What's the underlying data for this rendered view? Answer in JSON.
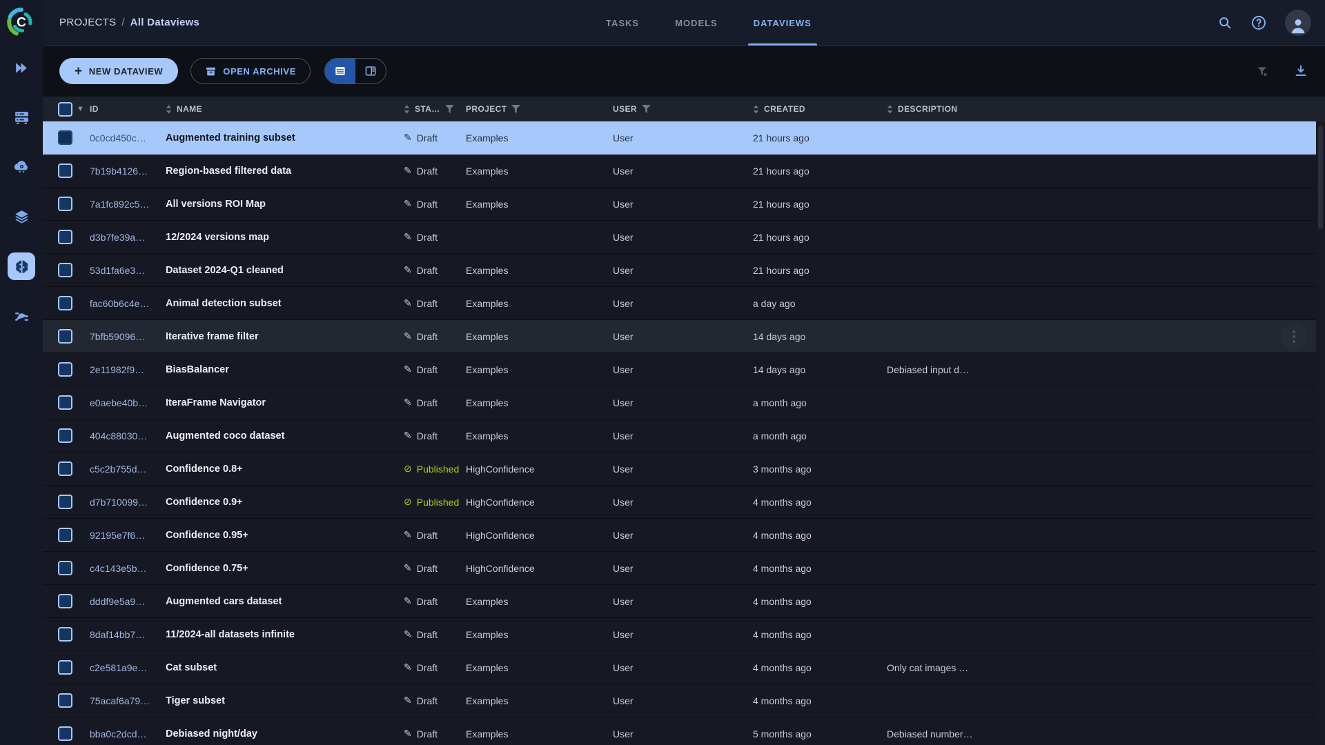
{
  "colors": {
    "accent_blue": "#85b1f4",
    "button_fill": "#a7c8fb",
    "selected_row_bg": "#a7c8fb",
    "published_green": "#a6d413",
    "row_bg": "#161923",
    "header_bg": "#171c2a",
    "table_header_bg": "#1e222d"
  },
  "sidebar": {
    "logo": "clearml-logo",
    "items": [
      {
        "name": "projects",
        "icon": "double-chevron-right-icon",
        "active": false
      },
      {
        "name": "workers-queues",
        "icon": "server-racks-icon",
        "active": false
      },
      {
        "name": "cloud-autoscale",
        "icon": "cloud-gear-icon",
        "active": false
      },
      {
        "name": "datasets",
        "icon": "layers-icon",
        "active": false
      },
      {
        "name": "hyper-datasets",
        "icon": "brain-icon",
        "active": true
      },
      {
        "name": "pipelines",
        "icon": "pipeline-icon",
        "active": false
      }
    ]
  },
  "header": {
    "breadcrumb": {
      "root": "PROJECTS",
      "separator": "/",
      "current": "All Dataviews"
    },
    "tabs": [
      {
        "label": "TASKS",
        "active": false
      },
      {
        "label": "MODELS",
        "active": false
      },
      {
        "label": "DATAVIEWS",
        "active": true
      }
    ],
    "icons": [
      "search-icon",
      "help-icon",
      "user-avatar"
    ]
  },
  "toolbar": {
    "new_dataview_label": "NEW DATAVIEW",
    "open_archive_label": "OPEN ARCHIVE",
    "view_toggle": [
      "table-view",
      "split-view"
    ],
    "right_icons": [
      "clear-filters-icon",
      "download-icon"
    ]
  },
  "table": {
    "status_icons": {
      "draft": "✎",
      "published": "⊘"
    },
    "columns": [
      {
        "label": "ID",
        "sortable": false,
        "filterable": false
      },
      {
        "label": "NAME",
        "sortable": true,
        "filterable": false
      },
      {
        "label": "STA…",
        "sortable": true,
        "filterable": true
      },
      {
        "label": "PROJECT",
        "sortable": false,
        "filterable": true
      },
      {
        "label": "USER",
        "sortable": false,
        "filterable": true
      },
      {
        "label": "CREATED",
        "sortable": true,
        "filterable": false
      },
      {
        "label": "DESCRIPTION",
        "sortable": true,
        "filterable": false
      }
    ],
    "rows": [
      {
        "id": "0c0cd450c…",
        "name": "Augmented training subset",
        "status": "Draft",
        "project": "Examples",
        "user": "User",
        "created": "21 hours ago",
        "description": "",
        "selected": true,
        "hovered": false
      },
      {
        "id": "7b19b4126…",
        "name": "Region-based filtered data",
        "status": "Draft",
        "project": "Examples",
        "user": "User",
        "created": "21 hours ago",
        "description": "",
        "selected": false,
        "hovered": false
      },
      {
        "id": "7a1fc892c5…",
        "name": "All versions ROI Map",
        "status": "Draft",
        "project": "Examples",
        "user": "User",
        "created": "21 hours ago",
        "description": "",
        "selected": false,
        "hovered": false
      },
      {
        "id": "d3b7fe39a…",
        "name": "12/2024 versions map",
        "status": "Draft",
        "project": "",
        "user": "User",
        "created": "21 hours ago",
        "description": "",
        "selected": false,
        "hovered": false
      },
      {
        "id": "53d1fa6e3…",
        "name": "Dataset 2024-Q1 cleaned",
        "status": "Draft",
        "project": "Examples",
        "user": "User",
        "created": "21 hours ago",
        "description": "",
        "selected": false,
        "hovered": false
      },
      {
        "id": "fac60b6c4e…",
        "name": "Animal detection subset",
        "status": "Draft",
        "project": "Examples",
        "user": "User",
        "created": "a day ago",
        "description": "",
        "selected": false,
        "hovered": false
      },
      {
        "id": "7bfb59096…",
        "name": "Iterative frame filter",
        "status": "Draft",
        "project": "Examples",
        "user": "User",
        "created": "14 days ago",
        "description": "",
        "selected": false,
        "hovered": true
      },
      {
        "id": "2e11982f9…",
        "name": "BiasBalancer",
        "status": "Draft",
        "project": "Examples",
        "user": "User",
        "created": "14 days ago",
        "description": "Debiased input d…",
        "selected": false,
        "hovered": false
      },
      {
        "id": "e0aebe40b…",
        "name": "IteraFrame Navigator",
        "status": "Draft",
        "project": "Examples",
        "user": "User",
        "created": "a month ago",
        "description": "",
        "selected": false,
        "hovered": false
      },
      {
        "id": "404c88030…",
        "name": "Augmented coco dataset",
        "status": "Draft",
        "project": "Examples",
        "user": "User",
        "created": "a month ago",
        "description": "",
        "selected": false,
        "hovered": false
      },
      {
        "id": "c5c2b755d…",
        "name": "Confidence 0.8+",
        "status": "Published",
        "project": "HighConfidence",
        "user": "User",
        "created": "3 months ago",
        "description": "",
        "selected": false,
        "hovered": false
      },
      {
        "id": "d7b710099…",
        "name": "Confidence 0.9+",
        "status": "Published",
        "project": "HighConfidence",
        "user": "User",
        "created": "4 months ago",
        "description": "",
        "selected": false,
        "hovered": false
      },
      {
        "id": "92195e7f6…",
        "name": "Confidence 0.95+",
        "status": "Draft",
        "project": "HighConfidence",
        "user": "User",
        "created": "4 months ago",
        "description": "",
        "selected": false,
        "hovered": false
      },
      {
        "id": "c4c143e5b…",
        "name": "Confidence 0.75+",
        "status": "Draft",
        "project": "HighConfidence",
        "user": "User",
        "created": "4 months ago",
        "description": "",
        "selected": false,
        "hovered": false
      },
      {
        "id": "dddf9e5a9…",
        "name": "Augmented cars dataset",
        "status": "Draft",
        "project": "Examples",
        "user": "User",
        "created": "4 months ago",
        "description": "",
        "selected": false,
        "hovered": false
      },
      {
        "id": "8daf14bb7…",
        "name": "11/2024-all datasets infinite",
        "status": "Draft",
        "project": "Examples",
        "user": "User",
        "created": "4 months ago",
        "description": "",
        "selected": false,
        "hovered": false
      },
      {
        "id": "c2e581a9e…",
        "name": "Cat subset",
        "status": "Draft",
        "project": "Examples",
        "user": "User",
        "created": "4 months ago",
        "description": "Only cat images …",
        "selected": false,
        "hovered": false
      },
      {
        "id": "75acaf6a79…",
        "name": "Tiger subset",
        "status": "Draft",
        "project": "Examples",
        "user": "User",
        "created": "4 months ago",
        "description": "",
        "selected": false,
        "hovered": false
      },
      {
        "id": "bba0c2dcd…",
        "name": "Debiased night/day",
        "status": "Draft",
        "project": "Examples",
        "user": "User",
        "created": "5 months ago",
        "description": "Debiased number…",
        "selected": false,
        "hovered": false
      }
    ]
  }
}
